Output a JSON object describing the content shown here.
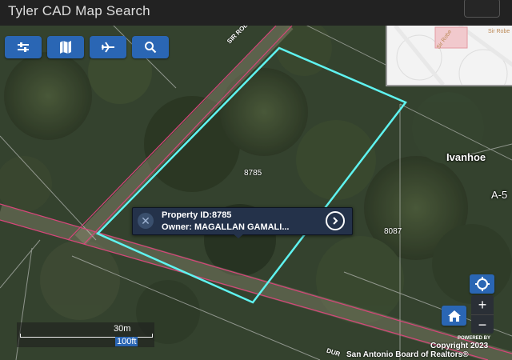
{
  "app_title": "Tyler CAD Map Search",
  "colors": {
    "accent": "#2a66b4",
    "parcel_highlight": "#5ff3f0",
    "road_line": "#d8457a",
    "popup_bg": "#24324a"
  },
  "toolbar": [
    {
      "name": "filter",
      "icon": "sliders-icon"
    },
    {
      "name": "map",
      "icon": "map-icon"
    },
    {
      "name": "flight",
      "icon": "airplane-icon"
    },
    {
      "name": "search",
      "icon": "search-icon"
    }
  ],
  "overview": {
    "street_label": "Sir Robe",
    "street_label_2": "Sir Robe"
  },
  "map_labels": {
    "parcel_main": "8785",
    "parcel_right": "8087",
    "place": "Ivanhoe",
    "place_partial": "A-5",
    "road_top": "SIR ROBERT BUR",
    "road_bottom": "DUR"
  },
  "popup": {
    "property_line": "Property ID:8785",
    "owner_line": "Owner: MAGALLAN GAMALI..."
  },
  "controls": {
    "zoom_in": "+",
    "zoom_out": "−"
  },
  "scale": {
    "metric": "30m",
    "imperial": "100ft"
  },
  "attribution": {
    "powered_by": "POWERED BY",
    "copyright": "Copyright 2023",
    "source": "San Antonio Board of Realtors®"
  }
}
